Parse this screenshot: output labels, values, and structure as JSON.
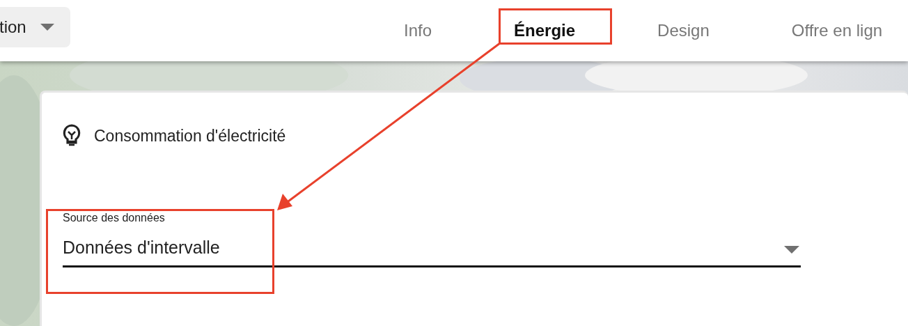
{
  "toolbar": {
    "dropdown": {
      "label": "tion"
    }
  },
  "tabs": [
    {
      "label": "Info",
      "selected": false
    },
    {
      "label": "Énergie",
      "selected": true
    },
    {
      "label": "Design",
      "selected": false
    },
    {
      "label": "Offre en lign",
      "selected": false
    }
  ],
  "card": {
    "title": "Consommation d'électricité",
    "field": {
      "label": "Source des données",
      "value": "Données d'intervalle"
    }
  }
}
